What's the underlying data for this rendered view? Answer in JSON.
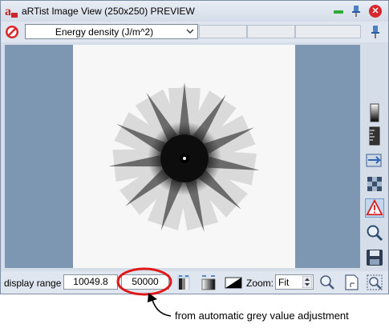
{
  "window": {
    "title": "aRTist Image View (250x250) PREVIEW",
    "app_icon": "artist-logo-icon",
    "controls": [
      "minimize-icon",
      "pin-icon",
      "close-icon"
    ]
  },
  "toolbar": {
    "quantity_select": {
      "selected": "Energy density (J/m^2)",
      "icon": "chevron-down-icon"
    },
    "no_entry_icon": "no-entry-icon",
    "side_pin_icon": "pin-icon"
  },
  "side_tools": [
    {
      "icon": "grey-scale-icon",
      "selected": false
    },
    {
      "icon": "ruler-scale-icon",
      "selected": false
    },
    {
      "icon": "export-image-icon",
      "selected": false
    },
    {
      "icon": "filter-icon",
      "selected": false
    },
    {
      "icon": "warning-icon",
      "selected": true
    },
    {
      "icon": "magnifier-icon",
      "selected": false
    },
    {
      "icon": "save-icon",
      "selected": false
    }
  ],
  "bottom": {
    "display_range_label": "display range",
    "range_min": "10049.8",
    "range_max": "50000",
    "zoom_label": "Zoom:",
    "zoom_value": "Fit",
    "icons": [
      "auto-range-icon",
      "fit-range-icon",
      "invert-gradient-icon",
      "zoom-icon",
      "page-icon",
      "zoom-fit-icon"
    ]
  },
  "annotation": {
    "text": "from automatic grey value adjustment",
    "highlight_color": "#e11818"
  },
  "colors": {
    "viewer_bg": "#7d97b3",
    "accent_red": "#e11818"
  }
}
